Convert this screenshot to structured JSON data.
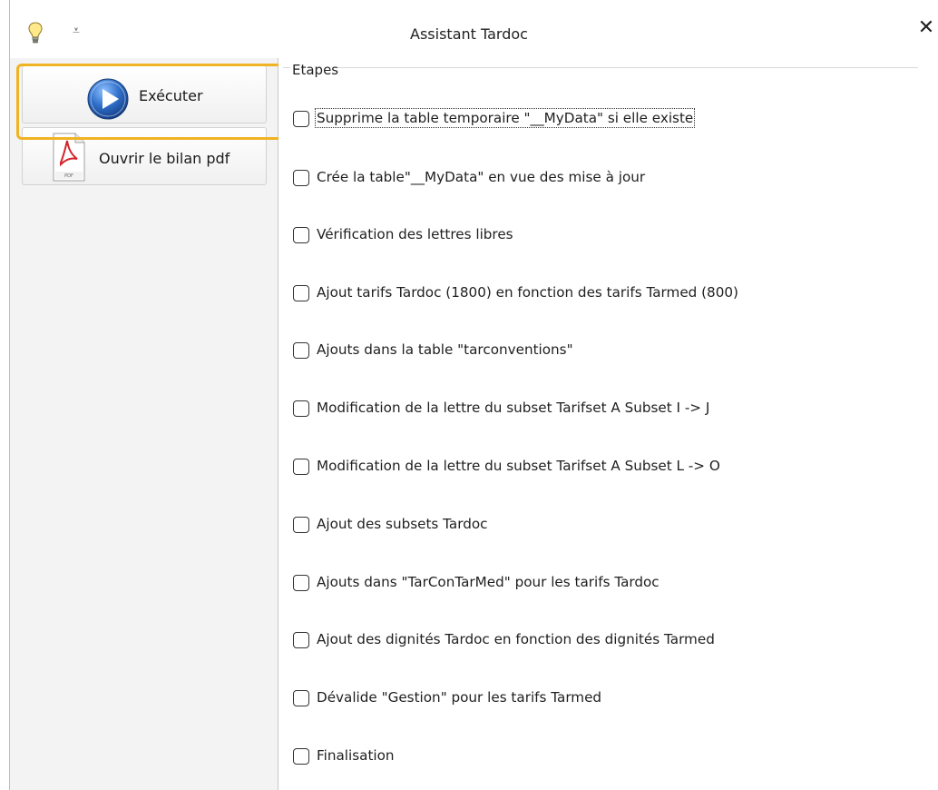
{
  "window": {
    "title": "Assistant Tardoc",
    "close_glyph": "✕"
  },
  "quick_access": {
    "menu_glyph": "⩡"
  },
  "toolbar": {
    "run_label": "Exécuter",
    "open_pdf_label": "Ouvrir le bilan pdf"
  },
  "steps_group": {
    "title": "Etapes",
    "items": [
      {
        "label": "Supprime la table temporaire \"__MyData\" si elle existe",
        "checked": false
      },
      {
        "label": "Crée la table\"__MyData\" en vue des mise à  jour",
        "checked": false
      },
      {
        "label": "Vérification des lettres libres",
        "checked": false
      },
      {
        "label": "Ajout tarifs Tardoc (1800) en fonction des tarifs Tarmed (800)",
        "checked": false
      },
      {
        "label": "Ajouts dans la table \"tarconventions\"",
        "checked": false
      },
      {
        "label": "Modification de la lettre du subset  Tarifset A Subset I -> J",
        "checked": false
      },
      {
        "label": "Modification de la lettre du subset  Tarifset A Subset L -> O",
        "checked": false
      },
      {
        "label": "Ajout des subsets Tardoc",
        "checked": false
      },
      {
        "label": "Ajouts dans \"TarConTarMed\" pour les tarifs Tardoc",
        "checked": false
      },
      {
        "label": "Ajout des dignités Tardoc en fonction des dignités Tarmed",
        "checked": false
      },
      {
        "label": "Dévalide \"Gestion\" pour les tarifs Tarmed",
        "checked": false
      },
      {
        "label": "Finalisation",
        "checked": false
      }
    ]
  },
  "colors": {
    "focus_ring": "#f0b323",
    "play_blue": "#2f6fc9"
  }
}
